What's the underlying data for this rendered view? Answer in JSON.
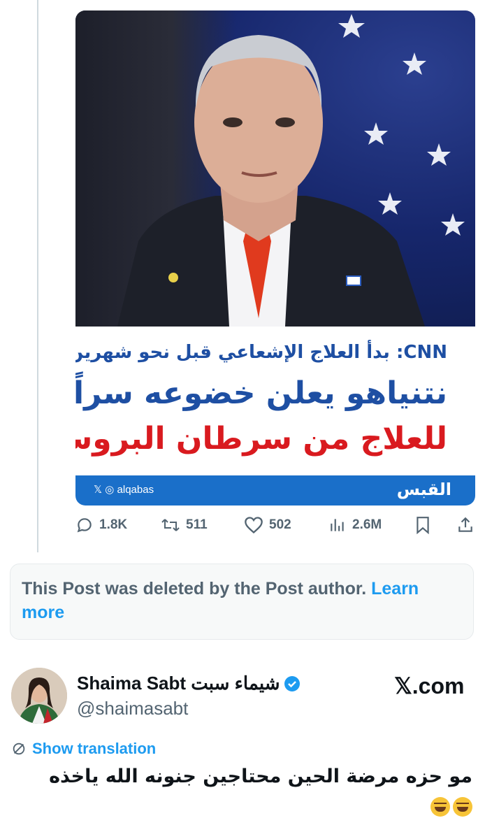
{
  "media": {
    "sub_headline": "CNN: بدأ العلاج الإشعاعي قبل نحو شهرين ونصف",
    "headline_blue": "نتنياهو يعلن خضوعه سراً",
    "headline_red": "للعلاج من سرطان البروستاتا",
    "brand_handle": "alqabas",
    "brand_logo": "القبس"
  },
  "actions": {
    "replies": "1.8K",
    "reposts": "511",
    "likes": "502",
    "views": "2.6M"
  },
  "deleted_notice": {
    "text": "This Post was deleted by the Post author.",
    "link": "Learn more"
  },
  "author": {
    "name": "Shaima Sabt شيماء سبت",
    "handle": "@shaimasabt",
    "source": ".com",
    "verified_icon": "verified-badge-icon"
  },
  "translation_label": "Show translation",
  "tweet_text": "مو حزه مرضة الحين محتاجين جنونه الله ياخذه",
  "colors": {
    "accent": "#1d9bf0",
    "brand_blue": "#1a6fc9",
    "headline_blue": "#1e4fa3",
    "headline_red": "#d91a1f",
    "muted": "#536471"
  }
}
